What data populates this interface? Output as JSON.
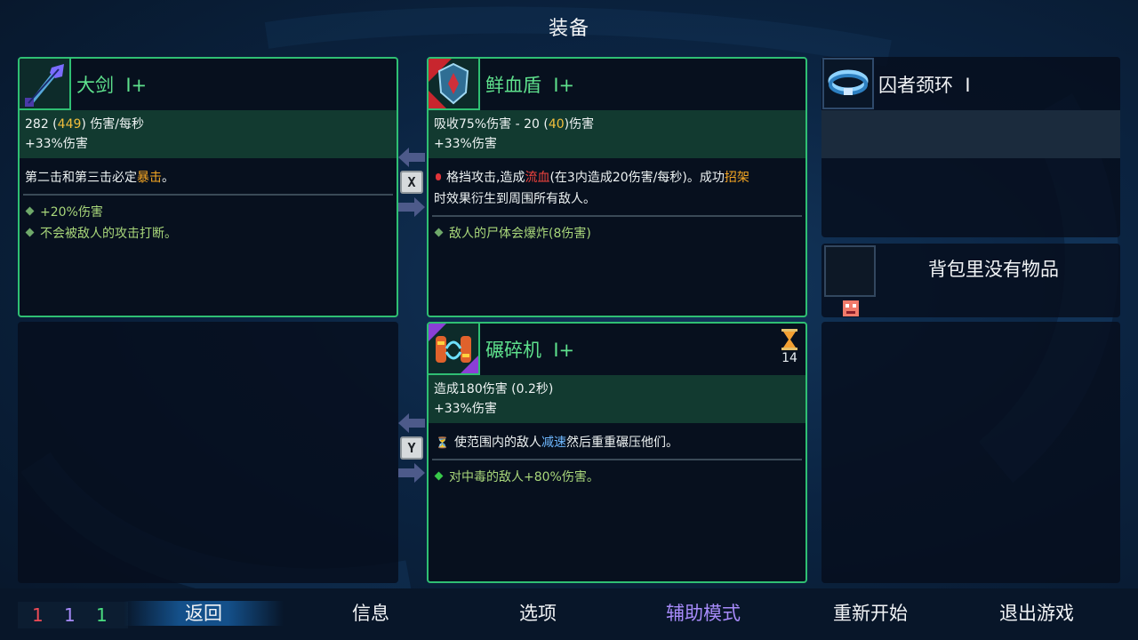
{
  "page_title": "装备",
  "weapon_main": {
    "name": "大剑",
    "tier": "I+",
    "dps_base": "282",
    "dps_boost": "449",
    "dps_unit": "伤害/每秒",
    "bonus": "+33%伤害",
    "desc_lead": "第二击和第三击必定",
    "desc_highlight": "暴击",
    "desc_tail": "。",
    "affixes": [
      "+20%伤害",
      "不会被敌人的攻击打断。"
    ],
    "icon": "greatsword-icon"
  },
  "weapon_shield": {
    "name": "鲜血盾",
    "tier": "I+",
    "stat_lead": "吸收75%伤害 - 20",
    "stat_boost": "40",
    "stat_tail": "伤害",
    "bonus": "+33%伤害",
    "desc_1": "格挡攻击,造成",
    "desc_bleed": "流血",
    "desc_2": "(在3内造成20伤害/每秒)。成功",
    "desc_parry": "招架",
    "desc_3": "时效果衍生到周围所有敌人。",
    "affixes": [
      "敌人的尸体会爆炸(8伤害)"
    ],
    "icon": "blood-shield-icon"
  },
  "skill": {
    "name": "碾碎机",
    "tier": "I+",
    "cooldown": "14",
    "stat": "造成180伤害 (0.2秒)",
    "bonus": "+33%伤害",
    "desc_1": "使范围内的敌人",
    "desc_slow": "减速",
    "desc_2": "然后重重碾压他们。",
    "affixes": [
      "对中毒的敌人+80%伤害。"
    ],
    "icon": "crusher-icon"
  },
  "swap_keys": {
    "top": "X",
    "bottom": "Y"
  },
  "amulet": {
    "name": "囚者颈环",
    "tier": "I",
    "icon": "amulet-icon"
  },
  "backpack": {
    "empty_text": "背包里没有物品"
  },
  "counters": [
    {
      "value": "1",
      "color": "#ef4b56"
    },
    {
      "value": "1",
      "color": "#a78bfa"
    },
    {
      "value": "1",
      "color": "#4ade80"
    }
  ],
  "nav": {
    "back": "返回",
    "info": "信息",
    "options": "选项",
    "assist": "辅助模式",
    "restart": "重新开始",
    "quit": "退出游戏"
  },
  "colors": {
    "card_border": "#2fbf73",
    "stat_band": "#123a30",
    "highlight_yellow": "#f1bf3c",
    "bleed_red": "#f0433d",
    "slow_blue": "#6fb8ff",
    "affix_green": "#a8d67a"
  }
}
